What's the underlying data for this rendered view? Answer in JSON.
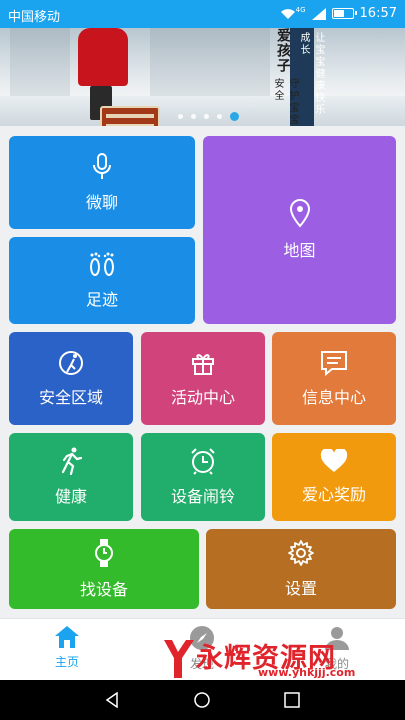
{
  "status_bar": {
    "carrier": "中国移动",
    "network": "4G",
    "time": "16:57",
    "battery_level": 0.6
  },
  "banner": {
    "title": "爱孩子",
    "slogan_1": "守护宝宝安全",
    "slogan_2": "让宝宝健康快乐成长",
    "dot_count": 5,
    "active_dot": 4
  },
  "tiles": {
    "chat": {
      "label": "微聊",
      "icon": "microphone-icon",
      "color": "#1a8ee6"
    },
    "map": {
      "label": "地图",
      "icon": "location-pin-icon",
      "color": "#9c5ee3"
    },
    "footprint": {
      "label": "足迹",
      "icon": "footprints-icon",
      "color": "#1a8ee6"
    },
    "safe_zone": {
      "label": "安全区域",
      "icon": "safe-zone-icon",
      "color": "#2b62c7"
    },
    "activity": {
      "label": "活动中心",
      "icon": "gift-icon",
      "color": "#d0447b"
    },
    "messages": {
      "label": "信息中心",
      "icon": "message-icon",
      "color": "#e27a3c"
    },
    "health": {
      "label": "健康",
      "icon": "runner-icon",
      "color": "#21ad6b"
    },
    "alarm": {
      "label": "设备闹铃",
      "icon": "alarm-clock-icon",
      "color": "#21ad6b"
    },
    "reward": {
      "label": "爱心奖励",
      "icon": "heart-icon",
      "color": "#f29a0e"
    },
    "find": {
      "label": "找设备",
      "icon": "watch-icon",
      "color": "#33bb2b"
    },
    "settings": {
      "label": "设置",
      "icon": "gear-icon",
      "color": "#b56e22"
    }
  },
  "tabbar": {
    "home": "主页",
    "discover": "发现",
    "mine": "我的",
    "accent": "#1aa3ef"
  },
  "watermark": {
    "name": "永辉资源网",
    "url": "www.yhkjjj.com"
  }
}
